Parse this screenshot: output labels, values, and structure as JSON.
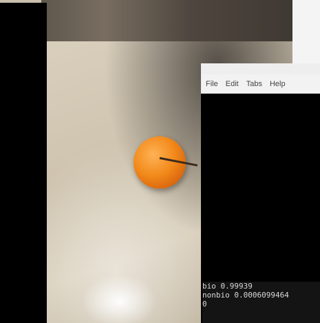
{
  "terminal": {
    "menu": [
      "File",
      "Edit",
      "Tabs",
      "Help"
    ],
    "output": [
      "bio 0.99939",
      "nonbio 0.0006099464",
      "0",
      "                            "
    ]
  },
  "colors": {
    "terminal_bg": "#000000",
    "menubar_bg": "#f2f2f2",
    "orange": "#f28a1b"
  }
}
